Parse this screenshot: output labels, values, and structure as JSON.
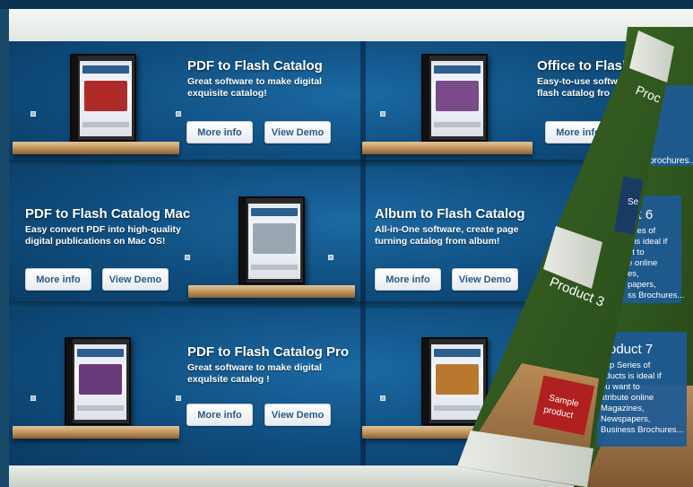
{
  "products": [
    {
      "title": "PDF to Flash Catalog",
      "desc": [
        "Great software to make digital",
        "exquisite catalog!"
      ],
      "more": "More info",
      "demo": "View Demo",
      "art": "#b12a2a"
    },
    {
      "title": "Office to Flash",
      "desc": [
        "Easy-to-use softw",
        "flash catalog fro"
      ],
      "more": "More info",
      "demo": "",
      "art": "#7a4a8a"
    },
    {
      "title": "PDF to Flash Catalog Mac",
      "desc": [
        "Easy convert PDF into high-quality",
        "digital publications on Mac OS!"
      ],
      "more": "More info",
      "demo": "View Demo",
      "art": "#9aa6b2"
    },
    {
      "title": "Album to Flash Catalog",
      "desc": [
        "All-in-One software, create page",
        "turning catalog from album!"
      ],
      "more": "More info",
      "demo": "View Demo",
      "art": "#8a5a3a"
    },
    {
      "title": "PDF to Flash Catalog Pro",
      "desc": [
        "Great software to make digital",
        "exqulsite catalog !"
      ],
      "more": "More info",
      "demo": "View Demo",
      "art": "#6a3a7a"
    },
    {
      "title": "",
      "desc": [],
      "more": "",
      "demo": "",
      "art": "#b8792e"
    }
  ],
  "book": {
    "proc_label": "Proc",
    "product3": "Product 3",
    "product6": [
      "ct 6",
      "eries of",
      "s is ideal if",
      "nt to",
      "e online",
      "es,",
      "papers,",
      "ss Brochures..."
    ],
    "product7": [
      "roduct 7",
      "Flip Series of",
      "oducts is ideal if",
      "ou want to",
      "stribute online",
      "Magazines,",
      "Newspapers,",
      "Business Brochures..."
    ],
    "brochures": "brochures...",
    "sample": [
      "Sample",
      "product"
    ],
    "badge": "Se"
  },
  "colors": {
    "accent": "#1b69a3",
    "button_text": "#2a5a86",
    "page_green": "#2f5a1f"
  }
}
